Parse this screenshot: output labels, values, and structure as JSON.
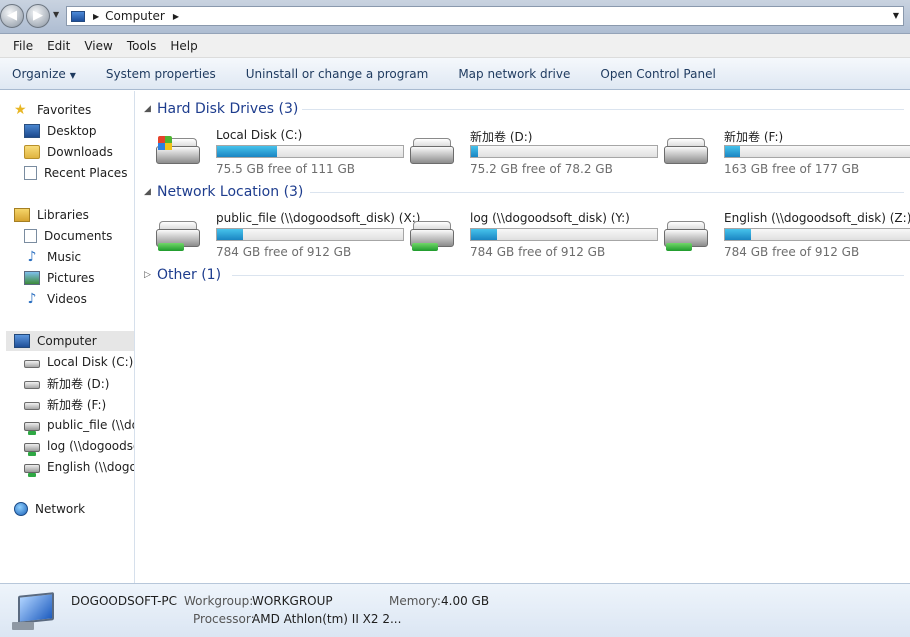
{
  "address": {
    "path": [
      "Computer"
    ]
  },
  "menu": [
    "File",
    "Edit",
    "View",
    "Tools",
    "Help"
  ],
  "commands": {
    "organize": "Organize",
    "items": [
      "System properties",
      "Uninstall or change a program",
      "Map network drive",
      "Open Control Panel"
    ]
  },
  "nav": {
    "favorites": "Favorites",
    "favorites_items": [
      "Desktop",
      "Downloads",
      "Recent Places"
    ],
    "libraries": "Libraries",
    "libraries_items": [
      "Documents",
      "Music",
      "Pictures",
      "Videos"
    ],
    "computer": "Computer",
    "computer_items": [
      "Local Disk (C:)",
      "新加卷 (D:)",
      "新加卷 (F:)",
      "public_file (\\\\dog",
      "log (\\\\dogoodso",
      "English (\\\\dogoc"
    ],
    "network": "Network"
  },
  "groups": {
    "hdd": {
      "title": "Hard Disk Drives (3)"
    },
    "net": {
      "title": "Network Location (3)"
    },
    "other": {
      "title": "Other (1)"
    }
  },
  "drives": [
    {
      "name": "Local Disk (C:)",
      "free": "75.5 GB free of 111 GB",
      "used_fraction": 0.32
    },
    {
      "name": "新加卷 (D:)",
      "free": "75.2 GB free of 78.2 GB",
      "used_fraction": 0.04
    },
    {
      "name": "新加卷 (F:)",
      "free": "163 GB free of 177 GB",
      "used_fraction": 0.08
    }
  ],
  "network_drives": [
    {
      "name": "public_file (\\\\dogoodsoft_disk) (X:)",
      "free": "784 GB free of 912 GB",
      "used_fraction": 0.14
    },
    {
      "name": "log (\\\\dogoodsoft_disk) (Y:)",
      "free": "784 GB free of 912 GB",
      "used_fraction": 0.14
    },
    {
      "name": "English (\\\\dogoodsoft_disk) (Z:)",
      "free": "784 GB free of 912 GB",
      "used_fraction": 0.14
    }
  ],
  "details": {
    "pc_name": "DOGOODSOFT-PC",
    "workgroup_label": "Workgroup:",
    "workgroup": "WORKGROUP",
    "memory_label": "Memory:",
    "memory": "4.00 GB",
    "processor_label": "Processor:",
    "processor": "AMD Athlon(tm) II X2 2..."
  }
}
